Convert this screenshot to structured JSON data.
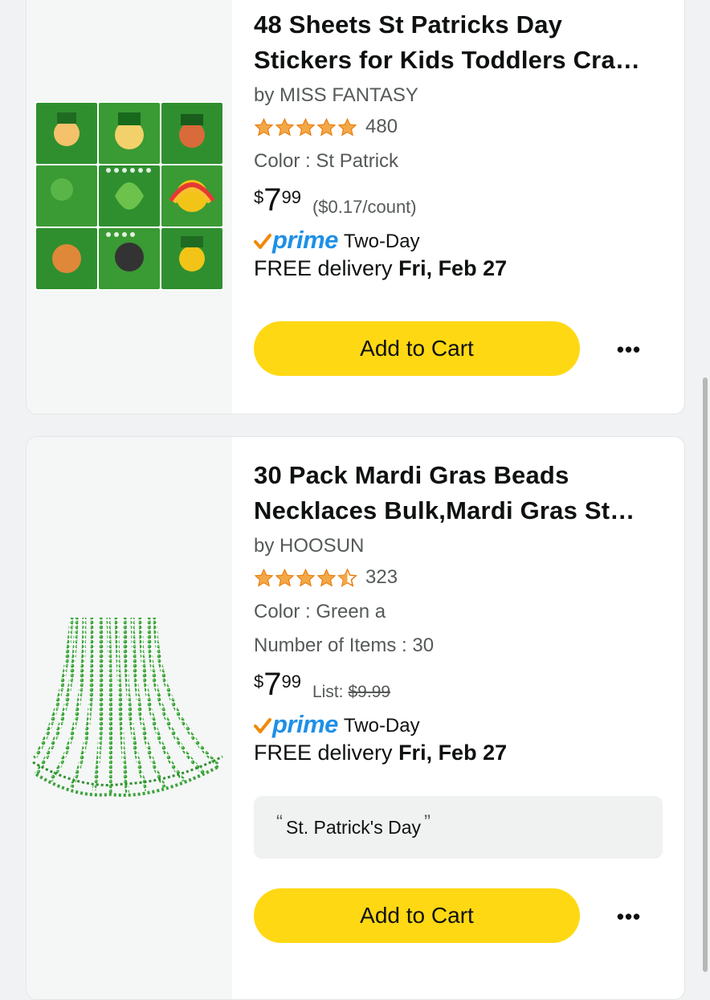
{
  "products": [
    {
      "title": "48 Sheets St Patricks Day Stickers for Kids Toddlers Cra…",
      "brand": "by MISS FANTASY",
      "rating_stars": 5,
      "rating_count": "480",
      "attributes": [
        "Color : St Patrick"
      ],
      "price_symbol": "$",
      "price_whole": "7",
      "price_fraction": "99",
      "unit_price": "($0.17/count)",
      "prime_label": "prime",
      "prime_speed": "Two-Day",
      "delivery_prefix": "FREE delivery",
      "delivery_date": "Fri, Feb 27",
      "cart_label": "Add to Cart",
      "more_label": "•••"
    },
    {
      "title": "30 Pack Mardi Gras Beads Necklaces Bulk,Mardi Gras St…",
      "brand": "by HOOSUN",
      "rating_stars": 4.5,
      "rating_count": "323",
      "attributes": [
        "Color : Green a",
        "Number of Items : 30"
      ],
      "price_symbol": "$",
      "price_whole": "7",
      "price_fraction": "99",
      "list_label": "List:",
      "list_price": "$9.99",
      "prime_label": "prime",
      "prime_speed": "Two-Day",
      "delivery_prefix": "FREE delivery",
      "delivery_date": "Fri, Feb 27",
      "tag_text": "St. Patrick's Day",
      "cart_label": "Add to Cart",
      "more_label": "•••"
    }
  ],
  "colors": {
    "star": "#f3a847",
    "star_outline": "#e77600",
    "prime_blue": "#1e90e6",
    "prime_check": "#f08804",
    "cart_yellow": "#ffd814",
    "sticker_green": "#2f8f2f",
    "beads_green": "#3aa33a"
  },
  "icons": [
    "star-icon",
    "half-star-icon",
    "prime-check-icon",
    "more-icon"
  ]
}
